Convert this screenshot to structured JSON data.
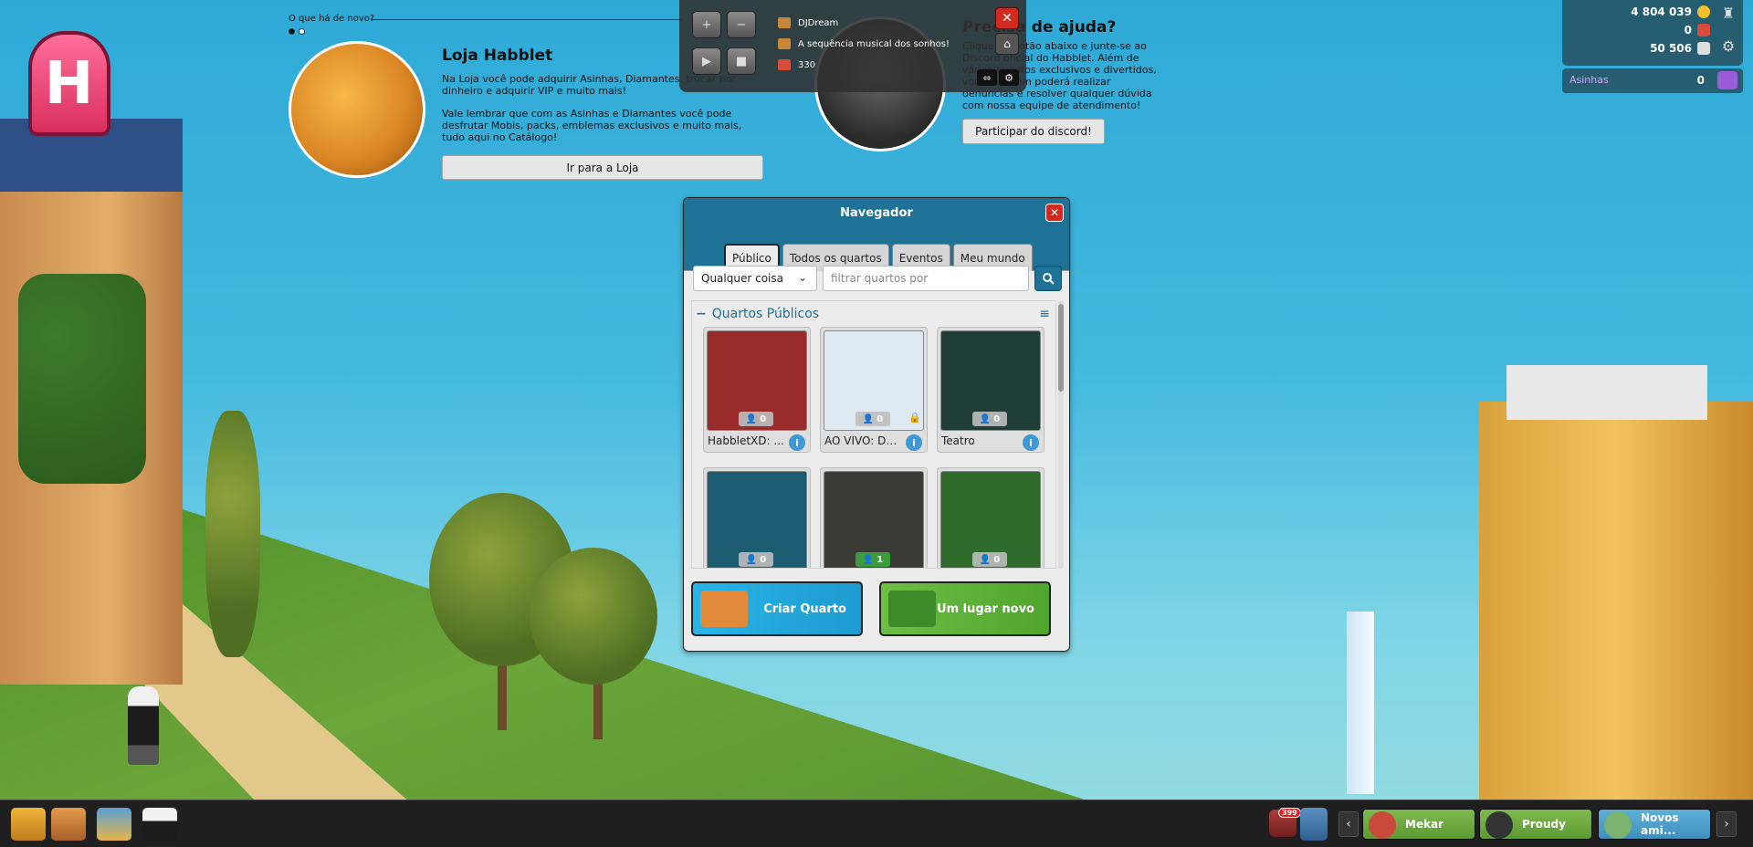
{
  "news": {
    "header": "O que há de novo?",
    "title": "Loja Habblet",
    "paragraph1": "Na Loja você pode adquirir Asinhas, Diamantes, trocar por dinheiro e adquirir VIP e muito mais!",
    "paragraph2": "Vale lembrar que com as Asinhas e Diamantes você pode desfrutar Mobis, packs, emblemas exclusivos e muito mais, tudo aqui no Catálogo!",
    "button": "Ir para a Loja"
  },
  "help": {
    "title": "Precisa de ajuda?",
    "text": "Clique no botão abaixo e junte-se ao Discord oficial do Habblet. Além de vários eventos exclusivos e divertidos, você também poderá realizar denúncias e resolver qualquer dúvida com nossa equipe de atendimento!",
    "button": "Participar do discord!"
  },
  "player": {
    "dj": "DJDream",
    "track": "A sequência musical dos sonhos!",
    "listeners": "330"
  },
  "currency": {
    "credits": "4 804 039",
    "diamonds": "0",
    "duckets": "50 506",
    "asinhas_label": "Asinhas",
    "asinhas_value": "0"
  },
  "navigator": {
    "title": "Navegador",
    "tabs": [
      "Público",
      "Todos os quartos",
      "Eventos",
      "Meu mundo"
    ],
    "active_tab": "Público",
    "filter_select": "Qualquer coisa",
    "search_placeholder": "filtrar quartos por",
    "section_title": "Quartos Públicos",
    "rooms": [
      {
        "name": "HabbletXD: ...",
        "users": "0",
        "locked": false,
        "color": "#9a2b2b"
      },
      {
        "name": "AO VIVO: De...",
        "users": "0",
        "locked": true,
        "color": "#dfe9f2"
      },
      {
        "name": "Teatro",
        "users": "0",
        "locked": false,
        "color": "#1f3d36"
      },
      {
        "name": "",
        "users": "0",
        "locked": false,
        "color": "#1b5c73"
      },
      {
        "name": "",
        "users": "1",
        "locked": false,
        "color": "#3b3b36"
      },
      {
        "name": "",
        "users": "0",
        "locked": false,
        "color": "#2f6b2a"
      }
    ],
    "create_room": "Criar Quarto",
    "random_room": "Um lugar novo"
  },
  "toolbar": {
    "friend_requests": "399",
    "friends": [
      {
        "name": "Mekar",
        "style": "green"
      },
      {
        "name": "Proudy",
        "style": "green"
      },
      {
        "name": "Novos ami...",
        "style": "blue"
      }
    ]
  },
  "colors": {
    "accent": "#1e7295",
    "create_button": "#29b4e6",
    "random_button": "#6dbe44",
    "close": "#d12b1f"
  }
}
